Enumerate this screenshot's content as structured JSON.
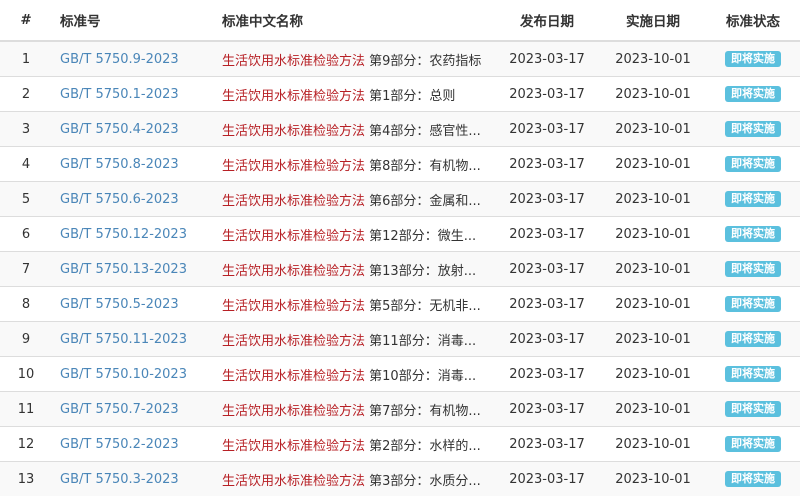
{
  "headers": {
    "index": "#",
    "code": "标准号",
    "title": "标准中文名称",
    "publish_date": "发布日期",
    "effective_date": "实施日期",
    "status": "标准状态"
  },
  "title_prefix": "生活饮用水标准检验方法",
  "rows": [
    {
      "index": "1",
      "code": "GB/T 5750.9-2023",
      "title_main": "生活饮用水标准检验方法",
      "title_sub": " 第9部分：农药指标",
      "publish": "2023-03-17",
      "effective": "2023-10-01",
      "status": "即将实施"
    },
    {
      "index": "2",
      "code": "GB/T 5750.1-2023",
      "title_main": "生活饮用水标准检验方法",
      "title_sub": " 第1部分：总则",
      "publish": "2023-03-17",
      "effective": "2023-10-01",
      "status": "即将实施"
    },
    {
      "index": "3",
      "code": "GB/T 5750.4-2023",
      "title_main": "生活饮用水标准检验方法",
      "title_sub": " 第4部分：感官性...",
      "publish": "2023-03-17",
      "effective": "2023-10-01",
      "status": "即将实施"
    },
    {
      "index": "4",
      "code": "GB/T 5750.8-2023",
      "title_main": "生活饮用水标准检验方法",
      "title_sub": " 第8部分：有机物...",
      "publish": "2023-03-17",
      "effective": "2023-10-01",
      "status": "即将实施"
    },
    {
      "index": "5",
      "code": "GB/T 5750.6-2023",
      "title_main": "生活饮用水标准检验方法",
      "title_sub": " 第6部分：金属和...",
      "publish": "2023-03-17",
      "effective": "2023-10-01",
      "status": "即将实施"
    },
    {
      "index": "6",
      "code": "GB/T 5750.12-2023",
      "title_main": "生活饮用水标准检验方法",
      "title_sub": " 第12部分：微生...",
      "publish": "2023-03-17",
      "effective": "2023-10-01",
      "status": "即将实施"
    },
    {
      "index": "7",
      "code": "GB/T 5750.13-2023",
      "title_main": "生活饮用水标准检验方法",
      "title_sub": " 第13部分：放射...",
      "publish": "2023-03-17",
      "effective": "2023-10-01",
      "status": "即将实施"
    },
    {
      "index": "8",
      "code": "GB/T 5750.5-2023",
      "title_main": "生活饮用水标准检验方法",
      "title_sub": " 第5部分：无机非...",
      "publish": "2023-03-17",
      "effective": "2023-10-01",
      "status": "即将实施"
    },
    {
      "index": "9",
      "code": "GB/T 5750.11-2023",
      "title_main": "生活饮用水标准检验方法",
      "title_sub": " 第11部分：消毒...",
      "publish": "2023-03-17",
      "effective": "2023-10-01",
      "status": "即将实施"
    },
    {
      "index": "10",
      "code": "GB/T 5750.10-2023",
      "title_main": "生活饮用水标准检验方法",
      "title_sub": " 第10部分：消毒...",
      "publish": "2023-03-17",
      "effective": "2023-10-01",
      "status": "即将实施"
    },
    {
      "index": "11",
      "code": "GB/T 5750.7-2023",
      "title_main": "生活饮用水标准检验方法",
      "title_sub": " 第7部分：有机物...",
      "publish": "2023-03-17",
      "effective": "2023-10-01",
      "status": "即将实施"
    },
    {
      "index": "12",
      "code": "GB/T 5750.2-2023",
      "title_main": "生活饮用水标准检验方法",
      "title_sub": " 第2部分：水样的...",
      "publish": "2023-03-17",
      "effective": "2023-10-01",
      "status": "即将实施"
    },
    {
      "index": "13",
      "code": "GB/T 5750.3-2023",
      "title_main": "生活饮用水标准检验方法",
      "title_sub": " 第3部分：水质分...",
      "publish": "2023-03-17",
      "effective": "2023-10-01",
      "status": "即将实施"
    }
  ],
  "colors": {
    "link": "#4a86b8",
    "title_prefix": "#b72025",
    "badge": "#5bc0de",
    "stripe": "#f9f9f9"
  }
}
